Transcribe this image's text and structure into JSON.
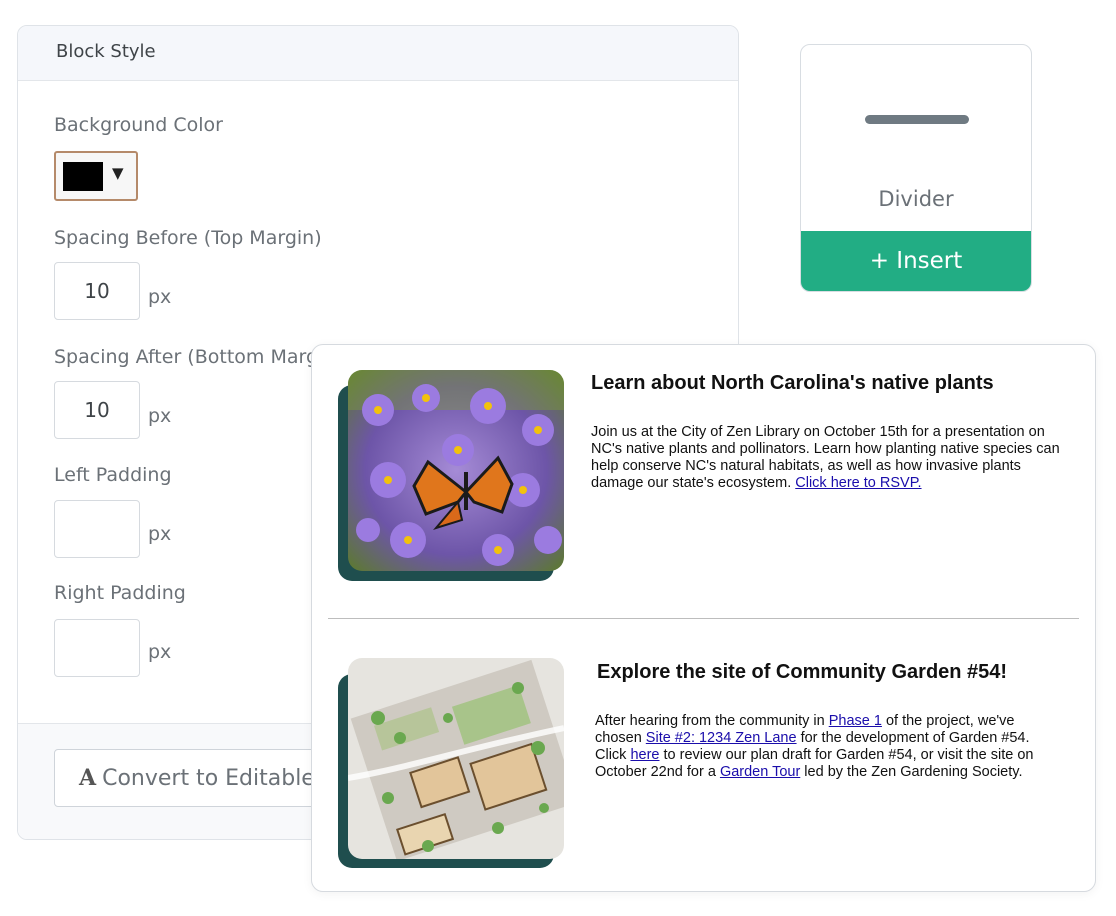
{
  "block_style": {
    "header": "Block Style",
    "background_color_label": "Background Color",
    "background_color_value": "#000000",
    "caret": "▼",
    "spacing_before_label": "Spacing Before (Top Margin)",
    "spacing_before_value": "10",
    "spacing_after_label": "Spacing After (Bottom Margin)",
    "spacing_after_value": "10",
    "left_padding_label": "Left Padding",
    "left_padding_value": "",
    "right_padding_label": "Right Padding",
    "right_padding_value": "",
    "unit": "px",
    "convert_icon": "A",
    "convert_label": "Convert to Editable"
  },
  "divider_card": {
    "label": "Divider",
    "insert_label": "+ Insert"
  },
  "email": {
    "article1": {
      "title": "Learn about North Carolina's native plants",
      "body": "Join us at the City of Zen Library on October 15th for a presentation on NC's native plants and pollinators. Learn how planting native species can help conserve NC's natural habitats, as well as how invasive plants damage our state's ecosystem. ",
      "link": "Click here to RSVP."
    },
    "article2": {
      "title": "Explore the site of Community Garden #54!",
      "t1": "After hearing from the community in ",
      "l1": "Phase 1",
      "t2": " of the project, we've chosen ",
      "l2": "Site #2: 1234 Zen Lane",
      "t3": " for the development of Garden #54. Click ",
      "l3": "here",
      "t4": " to review our plan draft for Garden #54, or visit the site on October 22nd for a ",
      "l4": "Garden Tour",
      "t5": " led by the Zen Gardening Society."
    }
  }
}
